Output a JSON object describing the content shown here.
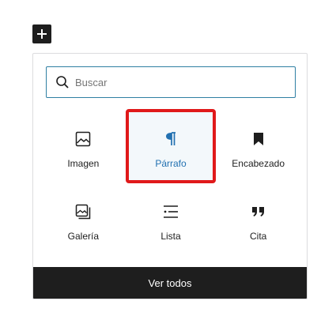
{
  "add_button": {
    "icon": "plus-icon"
  },
  "search": {
    "placeholder": "Buscar",
    "value": "",
    "icon": "search-icon"
  },
  "blocks": [
    {
      "label": "Imagen",
      "icon": "image-icon"
    },
    {
      "label": "Párrafo",
      "icon": "paragraph-icon",
      "selected": true
    },
    {
      "label": "Encabezado",
      "icon": "bookmark-icon"
    },
    {
      "label": "Galería",
      "icon": "gallery-icon"
    },
    {
      "label": "Lista",
      "icon": "list-icon"
    },
    {
      "label": "Cita",
      "icon": "quote-icon"
    }
  ],
  "footer": {
    "label": "Ver todos"
  },
  "colors": {
    "accent": "#2271b1",
    "highlight": "#e0191a",
    "dark": "#1e1e1e"
  }
}
